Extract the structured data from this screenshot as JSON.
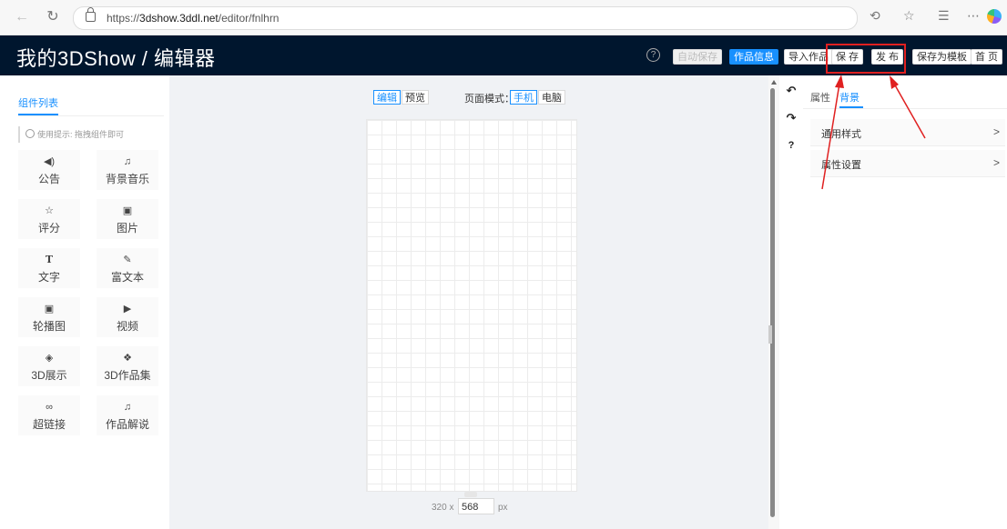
{
  "browser": {
    "url_prefix": "https://",
    "url_domain": "3dshow.3ddl.net",
    "url_path": "/editor/fnlhrn"
  },
  "header": {
    "title": "我的3DShow / 编辑器",
    "help": "?",
    "buttons": {
      "autosave": "自动保存",
      "info": "作品信息",
      "import": "导入作品",
      "save": "保 存",
      "publish": "发 布",
      "save_template": "保存为模板",
      "home": "首 页"
    }
  },
  "left_panel": {
    "tab": "组件列表",
    "tip": "使用提示: 拖拽组件即可",
    "components": [
      {
        "icon": "◀)",
        "label": "公告"
      },
      {
        "icon": "♫",
        "label": "背景音乐"
      },
      {
        "icon": "☆",
        "label": "评分"
      },
      {
        "icon": "▣",
        "label": "图片"
      },
      {
        "icon": "T",
        "label": "文字"
      },
      {
        "icon": "✎",
        "label": "富文本"
      },
      {
        "icon": "▣",
        "label": "轮播图"
      },
      {
        "icon": "▶",
        "label": "视频"
      },
      {
        "icon": "◈",
        "label": "3D展示"
      },
      {
        "icon": "❖",
        "label": "3D作品集"
      },
      {
        "icon": "∞",
        "label": "超链接"
      },
      {
        "icon": "♫",
        "label": "作品解说"
      }
    ]
  },
  "canvas": {
    "edit": "编辑",
    "preview": "预览",
    "mode_label": "页面模式：",
    "mobile": "手机",
    "desktop": "电脑",
    "width_text": "320 x",
    "height_value": "568",
    "unit": "px"
  },
  "tools": {
    "undo": "↶",
    "redo": "↷",
    "help": "?"
  },
  "right_panel": {
    "tabs": [
      "属性",
      "背景"
    ],
    "rows": [
      {
        "label": "通用样式",
        "chevron": ">"
      },
      {
        "label": "属性设置",
        "chevron": ">"
      }
    ]
  },
  "colors": {
    "header_bg": "#00162e",
    "primary": "#1890ff",
    "annotation": "#e02020"
  }
}
